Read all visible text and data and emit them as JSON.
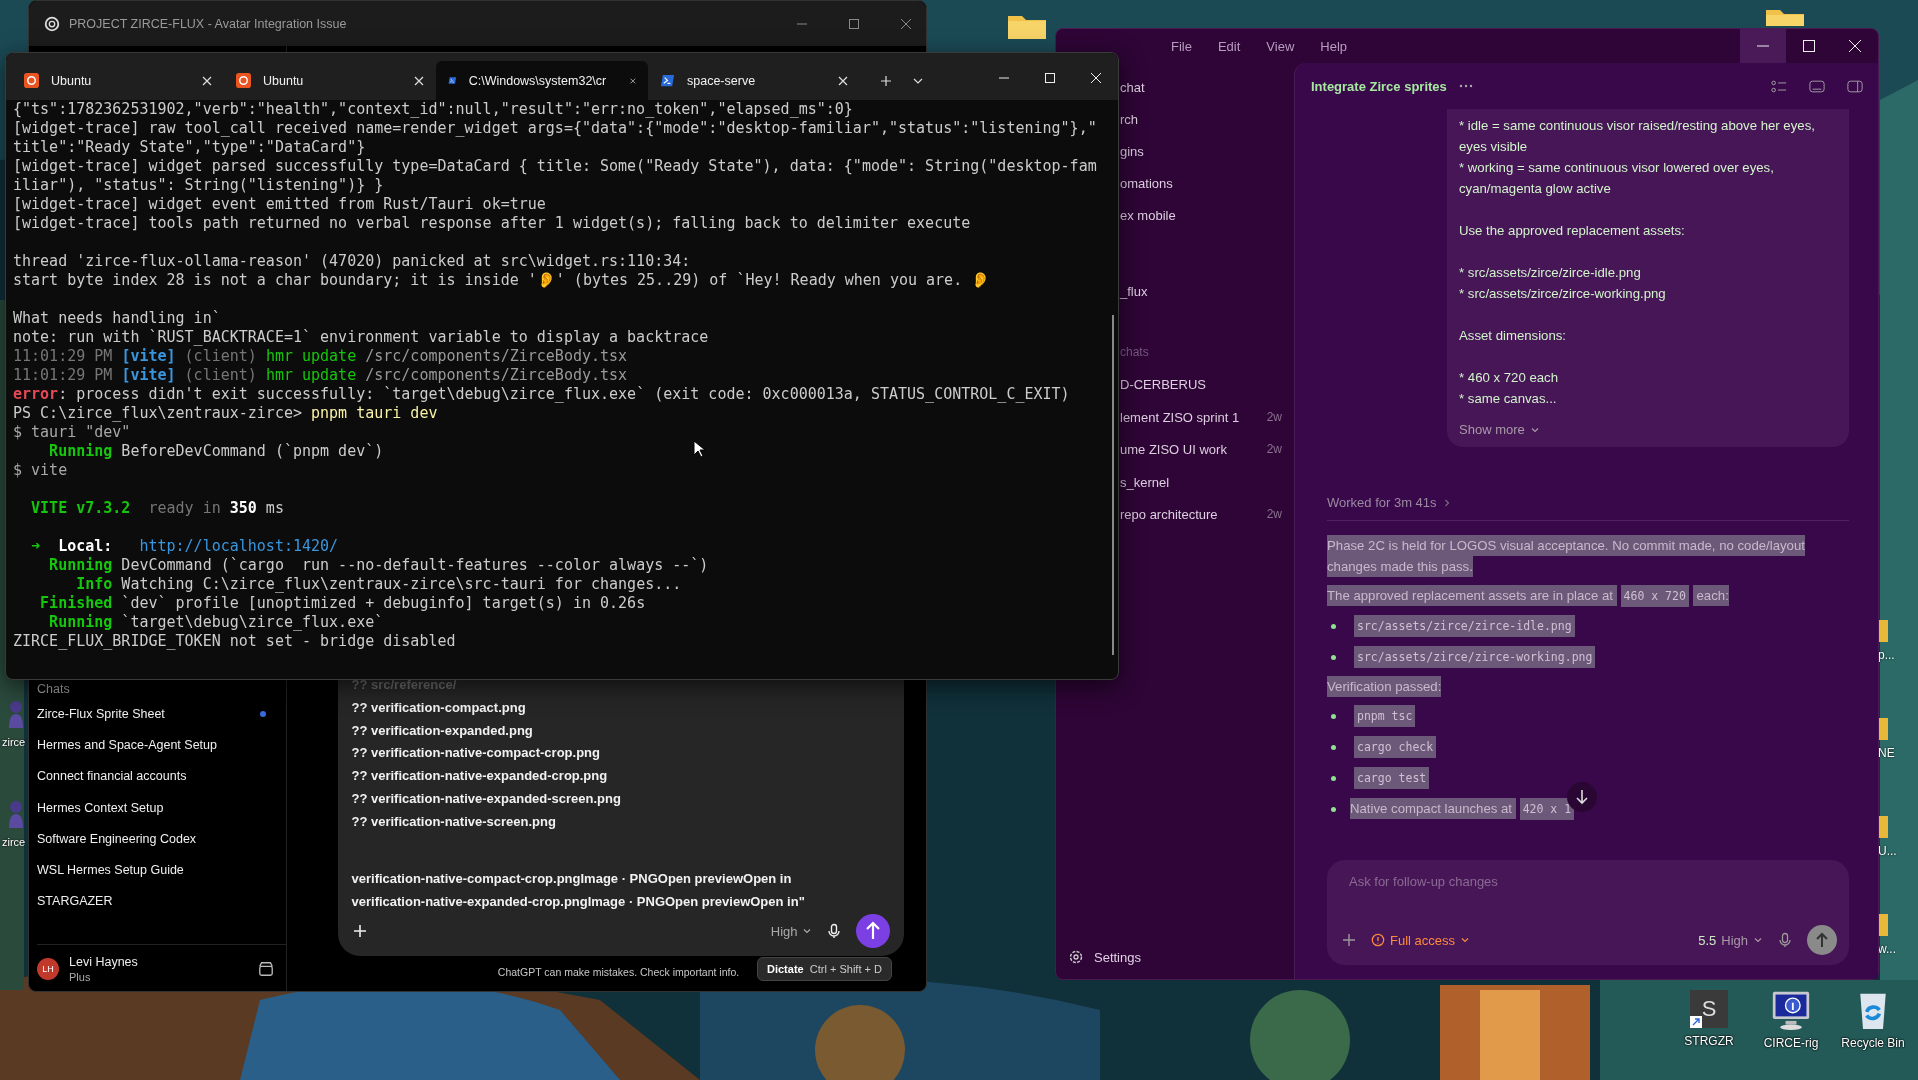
{
  "desktop": {
    "left_icons": [
      {
        "label": "zirce"
      },
      {
        "label": "zirce"
      }
    ],
    "edge_labels": [
      "p...",
      "NE",
      "U...",
      "w..."
    ],
    "icons": [
      {
        "label": "STRGZR",
        "kind": "shortcut",
        "letter": "S"
      },
      {
        "label": "CIRCE-rig",
        "kind": "monitor"
      },
      {
        "label": "Recycle Bin",
        "kind": "recycle"
      }
    ]
  },
  "chat_window": {
    "title": "PROJECT ZIRCE-FLUX - Avatar Integration Issue",
    "section": "Chats",
    "chats": [
      {
        "title": "Zirce-Flux Sprite Sheet",
        "unread": true
      },
      {
        "title": "Hermes and Space-Agent Setup",
        "unread": false
      },
      {
        "title": "Connect financial accounts",
        "unread": false
      },
      {
        "title": "Hermes Context Setup",
        "unread": false
      },
      {
        "title": "Software Engineering Codex",
        "unread": false
      },
      {
        "title": "WSL Hermes Setup Guide",
        "unread": false
      },
      {
        "title": "STARGAZER",
        "unread": false
      }
    ],
    "user": {
      "initials": "LH",
      "name": "Levi Haynes",
      "plan": "Plus"
    },
    "composer": {
      "file_lines": [
        {
          "text": "?? src/reference/",
          "faded": true
        },
        {
          "text": "?? verification-compact.png",
          "faded": false
        },
        {
          "text": "?? verification-expanded.png",
          "faded": false
        },
        {
          "text": "?? verification-native-compact-crop.png",
          "faded": false
        },
        {
          "text": "?? verification-native-expanded-crop.png",
          "faded": false
        },
        {
          "text": "?? verification-native-expanded-screen.png",
          "faded": false
        },
        {
          "text": "?? verification-native-screen.png",
          "faded": false
        }
      ],
      "paste_lines": [
        "verification-native-compact-crop.pngImage · PNGOpen previewOpen in",
        "verification-native-expanded-crop.pngImage · PNGOpen previewOpen in\""
      ],
      "effort": "High"
    },
    "disclaimer": "ChatGPT can make mistakes. Check important info.",
    "tooltip": {
      "label": "Dictate",
      "shortcut": "Ctrl + Shift + D"
    }
  },
  "codex_window": {
    "menu": [
      "File",
      "Edit",
      "View",
      "Help"
    ],
    "nav": [
      "chat",
      "rch",
      "gins",
      "omations",
      "ex mobile"
    ],
    "project": "_flux",
    "section": "chats",
    "threads": [
      {
        "title": "D-CERBERUS"
      },
      {
        "title": "lement ZISO sprint 1",
        "age": "2w"
      },
      {
        "title": "ume ZISO UI work",
        "age": "2w"
      },
      {
        "title": "s_kernel"
      },
      {
        "title": "repo architecture",
        "age": "2w"
      }
    ],
    "settings": "Settings",
    "thread_title": "Integrate Zirce sprites",
    "user_message": [
      [
        "* idle = same continuous visor raised/resting above her eyes, eyes visible",
        "* working = same continuous visor lowered over eyes, cyan/magenta glow active"
      ],
      [
        "Use the approved replacement assets:"
      ],
      [
        "* src/assets/zirce/zirce-idle.png",
        "* src/assets/zirce/zirce-working.png"
      ],
      [
        "Asset dimensions:"
      ],
      [
        "* 460 x 720 each",
        "* same canvas..."
      ]
    ],
    "show_more": "Show more",
    "worked": "Worked for 3m 41s",
    "response_selected": true,
    "response": [
      {
        "kind": "paragraph",
        "parts": [
          {
            "kind": "text",
            "text": "Phase 2C is held for LOGOS visual acceptance. No commit made, no code/layout changes made this pass."
          }
        ]
      },
      {
        "kind": "paragraph",
        "parts": [
          {
            "kind": "text",
            "text": "The approved replacement assets are in place at "
          },
          {
            "kind": "code",
            "text": "460 x 720"
          },
          {
            "kind": "text",
            "text": " each:"
          }
        ]
      },
      {
        "kind": "list",
        "items": [
          [
            {
              "kind": "code",
              "text": "src/assets/zirce/zirce-idle.png"
            }
          ],
          [
            {
              "kind": "code",
              "text": "src/assets/zirce/zirce-working.png"
            }
          ]
        ]
      },
      {
        "kind": "paragraph",
        "parts": [
          {
            "kind": "text",
            "text": "Verification passed:"
          }
        ]
      },
      {
        "kind": "list",
        "items": [
          [
            {
              "kind": "code",
              "text": "pnpm tsc"
            }
          ],
          [
            {
              "kind": "code",
              "text": "cargo check"
            }
          ],
          [
            {
              "kind": "code",
              "text": "cargo test"
            }
          ],
          [
            {
              "kind": "text",
              "text": "Native compact launches at "
            },
            {
              "kind": "code",
              "text": "420 x 1"
            }
          ]
        ]
      }
    ],
    "composer": {
      "placeholder": "Ask for follow-up changes",
      "access": "Full access",
      "version": "5.5",
      "effort": "High"
    }
  },
  "terminal": {
    "tabs": [
      {
        "title": "Ubuntu",
        "kind": "ubuntu",
        "selected": false
      },
      {
        "title": "Ubuntu",
        "kind": "ubuntu",
        "selected": false
      },
      {
        "title": "C:\\Windows\\system32\\cr",
        "kind": "shell",
        "selected": true
      },
      {
        "title": "space-serve",
        "kind": "shell",
        "selected": false
      }
    ],
    "blocks": [
      [
        [
          {
            "text": "{\"ts\":1782362531902,\"verb\":\"health\",\"context_id\":null,\"result\":\"err:no_token\",\"elapsed_ms\":0}"
          }
        ],
        [
          {
            "text": "[widget-trace] raw tool_call received name=render_widget args={\"data\":{\"mode\":\"desktop-familiar\",\"status\":\"listening\"},\""
          }
        ],
        [
          {
            "text": "title\":\"Ready State\",\"type\":\"DataCard\"}"
          }
        ],
        [
          {
            "text": "[widget-trace] widget parsed successfully type=DataCard { title: Some(\"Ready State\"), data: {\"mode\": String(\"desktop-fam"
          }
        ],
        [
          {
            "text": "iliar\"), \"status\": String(\"listening\")} }"
          }
        ],
        [
          {
            "text": "[widget-trace] widget event emitted from Rust/Tauri ok=true"
          }
        ],
        [
          {
            "text": "[widget-trace] tools path returned no verbal response after 1 widget(s); falling back to delimiter execute"
          }
        ]
      ],
      [
        [
          {
            "text": "thread 'zirce-flux-ollama-reason' (47020) panicked at src\\widget.rs:110:34:"
          }
        ],
        [
          {
            "text": "start byte index 28 is not a char boundary; it is inside '👂' (bytes 25..29) of `Hey! Ready when you are. 👂"
          }
        ]
      ],
      [
        [
          {
            "text": "What needs handling in`"
          }
        ],
        [
          {
            "text": "note: run with `RUST_BACKTRACE=1` environment variable to display a backtrace"
          }
        ],
        [
          {
            "text": "11:01:29 PM ",
            "color": "#767676"
          },
          {
            "text": "[vite]",
            "color": "#3a96dd",
            "bold": true
          },
          {
            "text": " (client) ",
            "color": "#767676"
          },
          {
            "text": "hmr update ",
            "color": "#16c60c"
          },
          {
            "text": "/src/components/ZirceBody.tsx",
            "color": "#9a9a9a"
          }
        ],
        [
          {
            "text": "11:01:29 PM ",
            "color": "#767676"
          },
          {
            "text": "[vite]",
            "color": "#3a96dd",
            "bold": true
          },
          {
            "text": " (client) ",
            "color": "#767676"
          },
          {
            "text": "hmr update ",
            "color": "#16c60c"
          },
          {
            "text": "/src/components/ZirceBody.tsx",
            "color": "#9a9a9a"
          }
        ],
        [
          {
            "text": "error",
            "color": "#e74856",
            "bold": true
          },
          {
            "text": ": process didn't exit successfully: `target\\debug\\zirce_flux.exe` (exit code: 0xc000013a, STATUS_CONTROL_C_EXIT)"
          }
        ],
        [
          {
            "text": "PS C:\\zirce_flux\\zentraux-zirce> "
          },
          {
            "text": "pnpm tauri dev",
            "color": "#f9f1a5"
          }
        ],
        [
          {
            "text": "$ tauri \"dev\"",
            "color": "#a8a8a8"
          }
        ],
        [
          {
            "text": "    Running",
            "color": "#16c60c",
            "bold": true
          },
          {
            "text": " BeforeDevCommand (`pnpm dev`)"
          }
        ],
        [
          {
            "text": "$ vite",
            "color": "#a8a8a8"
          }
        ]
      ],
      [
        [
          {
            "text": "  VITE v7.3.2",
            "color": "#16c60c",
            "bold": true
          },
          {
            "text": "  ready in ",
            "color": "#767676"
          },
          {
            "text": "350",
            "bold": true,
            "color": "#ffffff"
          },
          {
            "text": " ms"
          }
        ]
      ],
      [
        [
          {
            "text": "  ➜  ",
            "color": "#16c60c"
          },
          {
            "text": "Local:   ",
            "bold": true,
            "color": "#ffffff"
          },
          {
            "text": "http://localhost:1420/",
            "color": "#3a96dd"
          }
        ],
        [
          {
            "text": "    Running",
            "color": "#16c60c",
            "bold": true
          },
          {
            "text": " DevCommand (`cargo  run --no-default-features --color always --`)"
          }
        ],
        [
          {
            "text": "       Info",
            "color": "#16c60c",
            "bold": true
          },
          {
            "text": " Watching C:\\zirce_flux\\zentraux-zirce\\src-tauri for changes..."
          }
        ],
        [
          {
            "text": "   Finished",
            "color": "#16c60c",
            "bold": true
          },
          {
            "text": " `dev` profile [unoptimized + debuginfo] target(s) in 0.26s"
          }
        ],
        [
          {
            "text": "    Running",
            "color": "#16c60c",
            "bold": true
          },
          {
            "text": " `target\\debug\\zirce_flux.exe`"
          }
        ],
        [
          {
            "text": "ZIRCE_FLUX_BRIDGE_TOKEN not set - bridge disabled"
          }
        ]
      ]
    ]
  }
}
